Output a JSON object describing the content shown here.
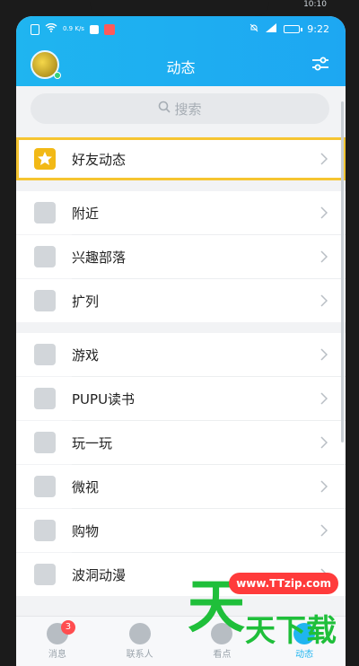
{
  "status_bar": {
    "outer_time": "10:10",
    "net_speed": "0.9\nK/s",
    "time": "9:22"
  },
  "header": {
    "title": "动态"
  },
  "search": {
    "placeholder": "搜索"
  },
  "list": {
    "highlighted": {
      "label": "好友动态"
    },
    "group1": [
      {
        "label": "附近"
      },
      {
        "label": "兴趣部落"
      },
      {
        "label": "扩列"
      }
    ],
    "group2": [
      {
        "label": "游戏"
      },
      {
        "label": "PUPU读书"
      },
      {
        "label": "玩一玩"
      },
      {
        "label": "微视"
      },
      {
        "label": "购物"
      },
      {
        "label": "波洞动漫"
      }
    ]
  },
  "tabbar": {
    "tabs": [
      {
        "label": "消息",
        "badge": "3"
      },
      {
        "label": "联系人"
      },
      {
        "label": "看点"
      },
      {
        "label": "动态"
      }
    ]
  },
  "watermark": {
    "url": "www.TTzip.com",
    "big": "天",
    "small": "天下载"
  },
  "colors": {
    "header_blue": "#1fb5f0",
    "highlight": "#f6c531",
    "badge_red": "#ff4d4f"
  }
}
